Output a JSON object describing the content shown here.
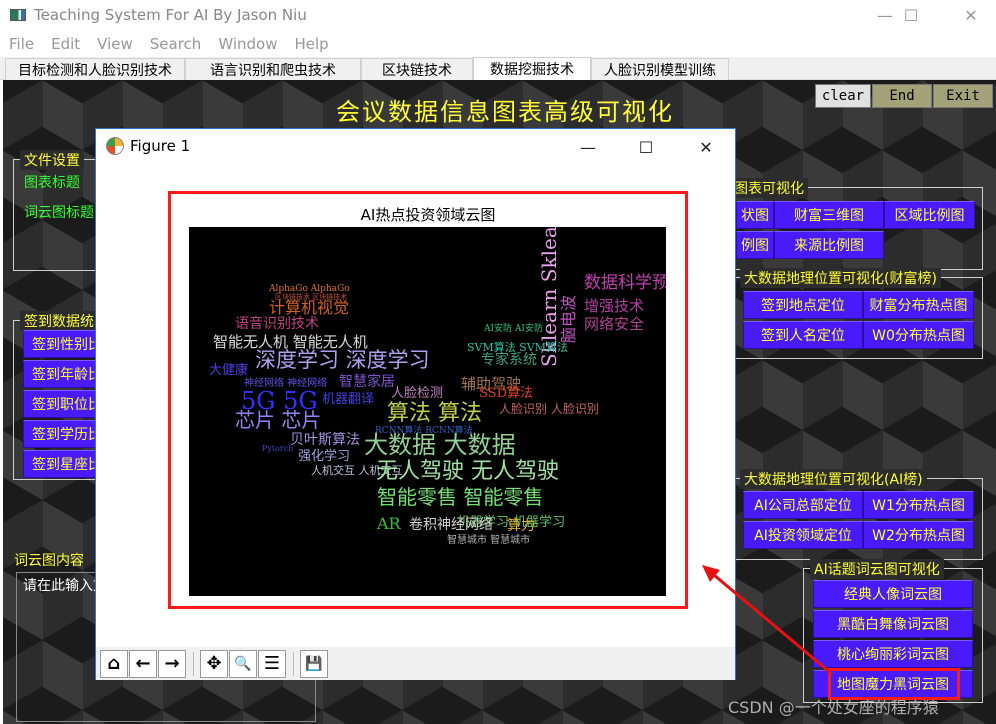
{
  "window": {
    "title": "Teaching System For AI By Jason Niu",
    "controls": {
      "minimize": "—",
      "maximize": "☐",
      "close": "✕"
    }
  },
  "menu": [
    "File",
    "Edit",
    "View",
    "Search",
    "Window",
    "Help"
  ],
  "tabs": [
    {
      "label": "目标检测和人脸识别技术",
      "active": false
    },
    {
      "label": "语言识别和爬虫技术",
      "active": false
    },
    {
      "label": "区块链技术",
      "active": false
    },
    {
      "label": "数据挖掘技术",
      "active": true
    },
    {
      "label": "人脸识别模型训练",
      "active": false
    }
  ],
  "main": {
    "title": "会议数据信息图表高级可视化",
    "top_buttons": {
      "clear": "clear",
      "end": "End",
      "exit": "Exit"
    },
    "file_settings": {
      "group_label": "文件设置",
      "chart_title_label": "图表标题",
      "cloud_title_label": "词云图标题"
    },
    "checkin_group": {
      "group_label": "签到数据统",
      "buttons": [
        "签到性别比",
        "签到年龄比",
        "签到职位比",
        "签到学历比",
        "签到星座比"
      ]
    },
    "cloud_content": {
      "label": "词云图内容",
      "placeholder": "请在此输入文"
    },
    "chart_group": {
      "group_label": "图表可视化",
      "row1": [
        "状图",
        "财富三维图",
        "区域比例图"
      ],
      "row2": [
        "例图",
        "来源比例图"
      ]
    },
    "geo_wealth_group": {
      "group_label": "大数据地理位置可视化(财富榜)",
      "buttons": [
        "签到地点定位",
        "财富分布热点图",
        "签到人名定位",
        "W0分布热点图"
      ]
    },
    "geo_ai_group": {
      "group_label": "大数据地理位置可视化(AI榜)",
      "buttons": [
        "AI公司总部定位",
        "W1分布热点图",
        "AI投资领域定位",
        "W2分布热点图"
      ]
    },
    "wordcloud_group": {
      "group_label": "AI话题词云图可视化",
      "buttons": [
        "经典人像词云图",
        "黑酷白舞像词云图",
        "桃心绚丽彩词云图",
        "地图魔力黑词云图"
      ],
      "highlighted": "地图魔力黑词云图"
    }
  },
  "figure": {
    "title": "Figure 1",
    "controls": {
      "minimize": "—",
      "maximize": "☐",
      "close": "✕"
    },
    "plot_title": "AI热点投资领域云图",
    "toolbar": [
      "home-icon",
      "back-icon",
      "forward-icon",
      "pan-icon",
      "zoom-icon",
      "configure-icon",
      "save-icon"
    ],
    "toolbar_glyphs": {
      "home": "⌂",
      "back": "←",
      "forward": "→",
      "pan": "✥",
      "zoom": "🔍",
      "configure": "☰",
      "save": "💾"
    },
    "words": [
      {
        "t": "Sklearn Sklearn",
        "c": "#e8a0e8"
      },
      {
        "t": "脑电波",
        "c": "#c050c0"
      },
      {
        "t": "数据科学预测",
        "c": "#c040b0"
      },
      {
        "t": "增强技术",
        "c": "#b040a0"
      },
      {
        "t": "网络安全",
        "c": "#b04090"
      },
      {
        "t": "AlphaGo AlphaGo",
        "c": "#e07020"
      },
      {
        "t": "区块链技术 区块链技术",
        "c": "#c05030"
      },
      {
        "t": "计算机视觉",
        "c": "#d06020"
      },
      {
        "t": "语音识别技术",
        "c": "#c04080"
      },
      {
        "t": "智能无人机 智能无人机",
        "c": "#d8d8d8"
      },
      {
        "t": "深度学习 深度学习",
        "c": "#b0a0f0"
      },
      {
        "t": "大健康",
        "c": "#5040e0"
      },
      {
        "t": "神经网络 神经网络",
        "c": "#6050e0"
      },
      {
        "t": "智慧家居",
        "c": "#8050d0"
      },
      {
        "t": "5G 5G",
        "c": "#3030ff"
      },
      {
        "t": "机器翻译",
        "c": "#4040e0"
      },
      {
        "t": "人脸检测",
        "c": "#c080c0"
      },
      {
        "t": "专家系统",
        "c": "#40a080"
      },
      {
        "t": "SVM算法 SVM算法",
        "c": "#30c0a0"
      },
      {
        "t": "AI安防 AI安防",
        "c": "#30c080"
      },
      {
        "t": "辅助驾驶",
        "c": "#a07050"
      },
      {
        "t": "SSD算法",
        "c": "#e04020"
      },
      {
        "t": "芯片 芯片",
        "c": "#9080f0"
      },
      {
        "t": "算法 算法",
        "c": "#c0d040"
      },
      {
        "t": "人脸识别 人脸识别",
        "c": "#c06060"
      },
      {
        "t": "RCNN算法 RCNN算法",
        "c": "#3060c0"
      },
      {
        "t": "贝叶斯算法",
        "c": "#a090e0"
      },
      {
        "t": "强化学习",
        "c": "#a0a0e0"
      },
      {
        "t": "大数据 大数据",
        "c": "#90d090"
      },
      {
        "t": "人机交互 人机交互",
        "c": "#c0c0e0"
      },
      {
        "t": "无人驾驶 无人驾驶",
        "c": "#a0e0a0"
      },
      {
        "t": "智能零售 智能零售",
        "c": "#70e070"
      },
      {
        "t": "AR",
        "c": "#30c030"
      },
      {
        "t": "机器学习 机器学习",
        "c": "#60c060"
      },
      {
        "t": "卷积神经网络",
        "c": "#d0d0d0"
      },
      {
        "t": "算力",
        "c": "#e0b020"
      },
      {
        "t": "智慧城市 智慧城市",
        "c": "#b0b0b0"
      },
      {
        "t": "Pytorch",
        "c": "#4040c0"
      }
    ]
  },
  "watermark": "CSDN @一个处女座的程序猿"
}
